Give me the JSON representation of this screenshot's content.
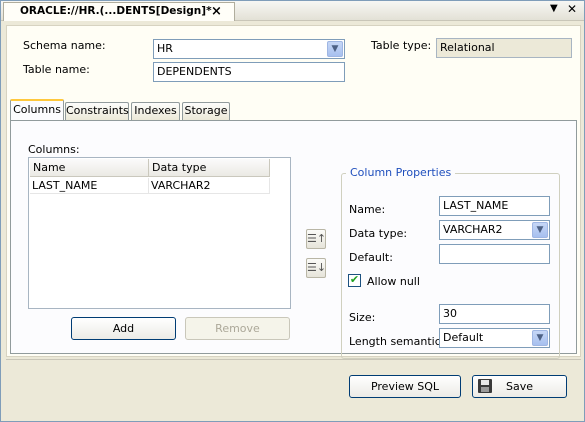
{
  "window": {
    "tab_title": "ORACLE://HR.(...DENTS[Design]*",
    "close_glyph": "×",
    "menu_glyph": "▼",
    "win_close_glyph": "✕"
  },
  "form": {
    "schema_label": "Schema name:",
    "schema_value": "HR",
    "table_label": "Table name:",
    "table_value": "DEPENDENTS",
    "type_label": "Table type:",
    "type_value": "Relational"
  },
  "tabs": [
    {
      "label": "Columns",
      "active": true
    },
    {
      "label": "Constraints",
      "active": false
    },
    {
      "label": "Indexes",
      "active": false
    },
    {
      "label": "Storage",
      "active": false
    }
  ],
  "columns": {
    "label": "Columns:",
    "headers": [
      "Name",
      "Data type"
    ],
    "rows": [
      {
        "name": "LAST_NAME",
        "type": "VARCHAR2"
      }
    ],
    "add_label": "Add",
    "remove_label": "Remove",
    "move_up_icon": "move-up-icon",
    "move_down_icon": "move-down-icon"
  },
  "properties": {
    "title": "Column Properties",
    "name_label": "Name:",
    "name_value": "LAST_NAME",
    "datatype_label": "Data type:",
    "datatype_value": "VARCHAR2",
    "default_label": "Default:",
    "default_value": "",
    "allow_null_label": "Allow null",
    "allow_null_checked": true,
    "size_label": "Size:",
    "size_value": "30",
    "length_label": "Length semantic:",
    "length_value": "Default"
  },
  "footer": {
    "preview_label": "Preview SQL",
    "save_label": "Save"
  },
  "colors": {
    "accent_tab": "#ffc83c",
    "group_title": "#1f4fbd",
    "field_border": "#7f9db9"
  }
}
